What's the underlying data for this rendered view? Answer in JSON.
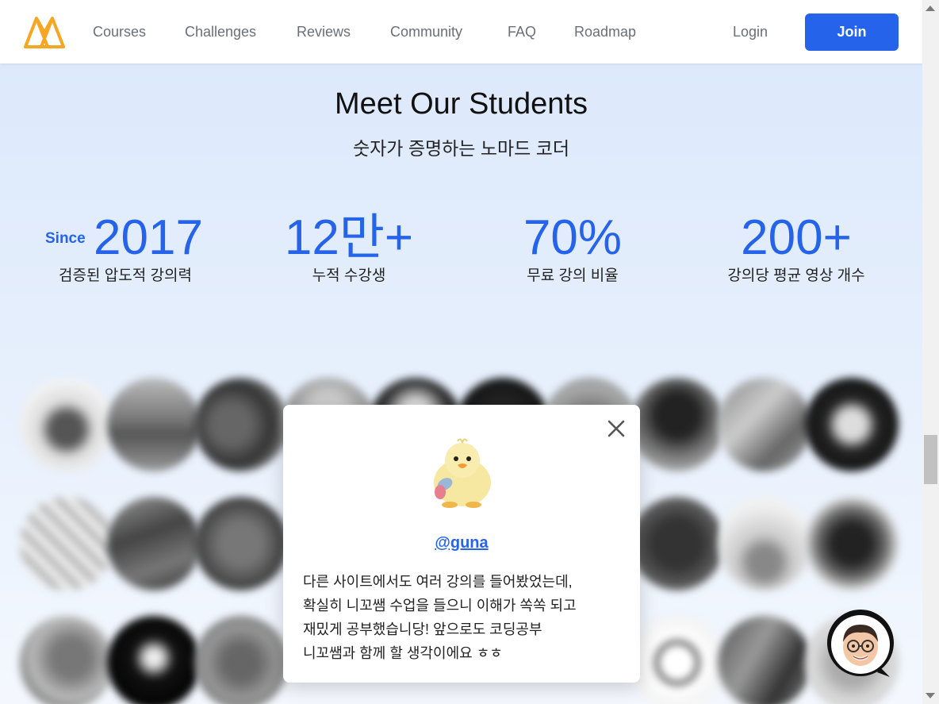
{
  "nav": {
    "items": [
      "Courses",
      "Challenges",
      "Reviews",
      "Community",
      "FAQ",
      "Roadmap"
    ],
    "login": "Login",
    "join": "Join"
  },
  "section": {
    "title": "Meet Our Students",
    "subtitle": "숫자가 증명하는 노마드 코더"
  },
  "stats": [
    {
      "prefix": "Since",
      "value": "2017",
      "label": "검증된 압도적 강의력"
    },
    {
      "prefix": "",
      "value": "12만+",
      "label": "누적 수강생"
    },
    {
      "prefix": "",
      "value": "70%",
      "label": "무료 강의 비율"
    },
    {
      "prefix": "",
      "value": "200+",
      "label": "강의당 평균 영상 개수"
    }
  ],
  "review": {
    "handle": "@guna",
    "lines": [
      "다른 사이트에서도 여러 강의를 들어봤었는데,",
      "확실히 니꼬쌤 수업을 들으니 이해가 쏙쏙 되고",
      "재밌게 공부했습니당! 앞으로도 코딩공부",
      "니꼬쌤과 함께 할 생각이에요 ㅎㅎ"
    ]
  },
  "colors": {
    "accent": "#2563eb",
    "logo": "#f5a623"
  },
  "icons": [
    "logo-icon",
    "close-icon",
    "chick-avatar-icon",
    "chat-avatar-icon"
  ]
}
